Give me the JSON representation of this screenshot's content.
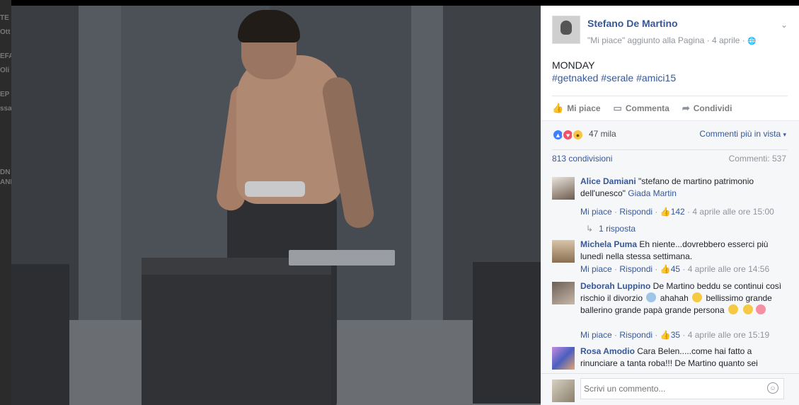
{
  "background": {
    "strip_text": [
      "TE",
      "Ott",
      "EFA",
      "Oli",
      "EP",
      "ssa",
      "DN",
      "ANI"
    ]
  },
  "post": {
    "page_name": "Stefano De Martino",
    "meta": "\"Mi piace\" aggiunto alla Pagina · 4 aprile · ",
    "globe_icon": "🌐",
    "text": "MONDAY",
    "hashtags": "#getnaked #serale #amici15"
  },
  "actions": {
    "like": "Mi piace",
    "comment": "Commenta",
    "share": "Condividi"
  },
  "reactions": {
    "count": "47 mila",
    "more_comments": "Commenti più in vista",
    "shares": "813 condivisioni",
    "comments_count": "Commenti: 537"
  },
  "comments": [
    {
      "name": "Alice Damiani",
      "text": "\"stefano de martino patrimonio dell'unesco\"",
      "mention": "Giada Martin",
      "like_label": "Mi piace",
      "reply_label": "Rispondi",
      "likes": "142",
      "time": "4 aprile alle ore 15:00",
      "replies": "1 risposta"
    },
    {
      "name": "Michela Puma",
      "text": "Eh niente...dovrebbero esserci più lunedì nella stessa settimana.",
      "like_label": "Mi piace",
      "reply_label": "Rispondi",
      "likes": "45",
      "time": "4 aprile alle ore 14:56"
    },
    {
      "name": "Deborah Luppino",
      "text_a": "De Martino beddu se continui così rischio il divorzio",
      "text_b": "ahahah",
      "text_c": "bellissimo grande ballerino grande papà grande persona",
      "like_label": "Mi piace",
      "reply_label": "Rispondi",
      "likes": "35",
      "time": "4 aprile alle ore 15:19"
    },
    {
      "name": "Rosa Amodio",
      "text": "Cara Belen.....come hai fatto a rinunciare a tanta roba!!! De Martino quanto sei"
    }
  ],
  "composer": {
    "placeholder": "Scrivi un commento..."
  },
  "colors": {
    "link": "#365899",
    "muted": "#90949c",
    "like": "#4080ff",
    "love": "#f25268",
    "wow": "#f7c545"
  }
}
